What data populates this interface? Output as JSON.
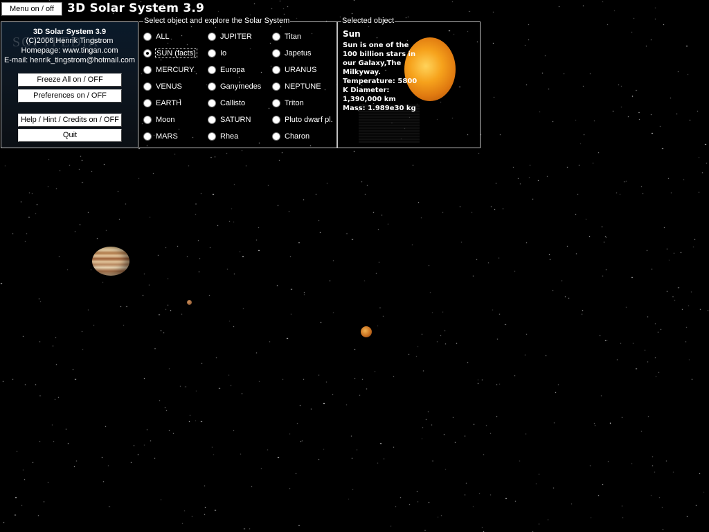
{
  "window": {
    "title": "3D Solar System 3.9"
  },
  "toolbar": {
    "menu_button": "Menu on / off"
  },
  "info_panel": {
    "title": "3D Solar System 3.9",
    "copyright": "(C)2006 Henrik Tingstrom",
    "homepage": "Homepage: www.tingan.com",
    "email": "E-mail: henrik_tingstrom@hotmail.com",
    "watermark": "SOFTPEDIA",
    "buttons": {
      "freeze": "Freeze All on / OFF",
      "preferences": "Preferences on / OFF",
      "help": "Help / Hint / Credits on / OFF",
      "quit": "Quit"
    }
  },
  "object_select": {
    "label": "Select object and explore the Solar System",
    "selected": "SUN (facts)",
    "columns": [
      [
        "ALL",
        "SUN (facts)",
        "MERCURY",
        "VENUS",
        "EARTH",
        "Moon",
        "MARS"
      ],
      [
        "JUPITER",
        "Io",
        "Europa",
        "Ganymedes",
        "Callisto",
        "SATURN",
        "Rhea"
      ],
      [
        "Titan",
        "Japetus",
        "URANUS",
        "NEPTUNE",
        "Triton",
        "Pluto dwarf pl.",
        "Charon"
      ]
    ]
  },
  "selected_object": {
    "label": "Selected object",
    "name": "Sun",
    "description": "Sun is one of the\n100 billion stars in\nour Galaxy,The\nMilkyway.\nTemperature: 5800\nK Diameter:\n1,390,000 km\nMass: 1.989e30 kg"
  },
  "scene": {
    "bodies": [
      "jupiter",
      "moon",
      "io"
    ],
    "background_color": "#000000"
  }
}
